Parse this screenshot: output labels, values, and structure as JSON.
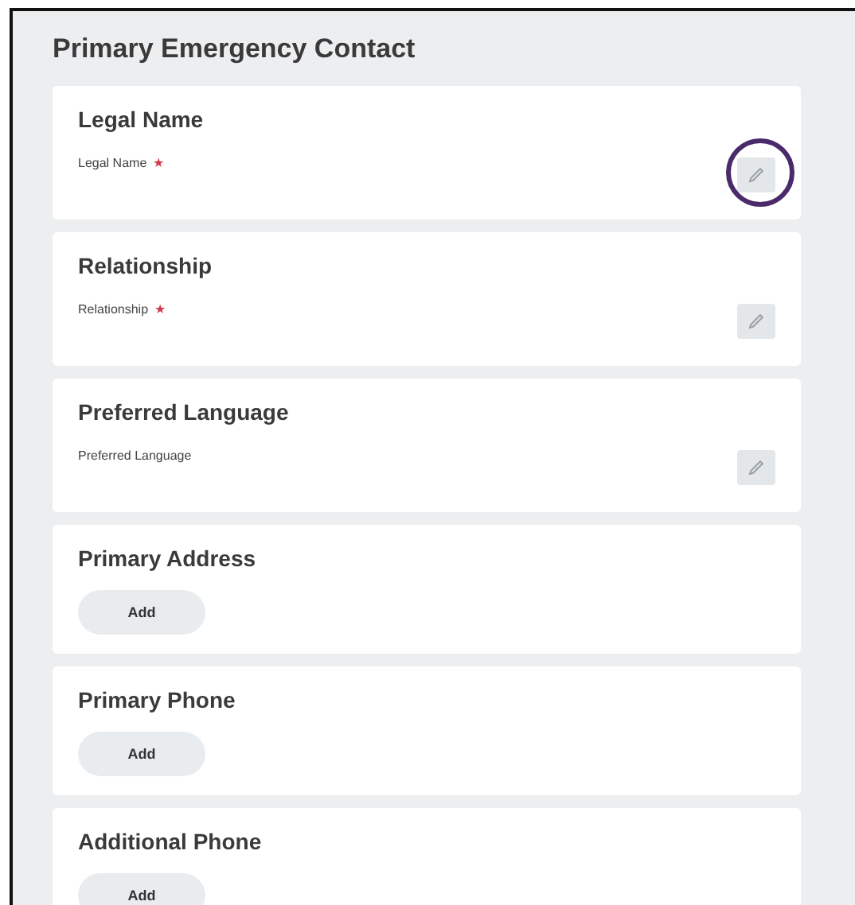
{
  "title": "Primary Emergency Contact",
  "sections": [
    {
      "kind": "field",
      "heading": "Legal Name",
      "label": "Legal Name",
      "required_mark": "★",
      "highlighted": true
    },
    {
      "kind": "field",
      "heading": "Relationship",
      "label": "Relationship",
      "required_mark": "★",
      "highlighted": false
    },
    {
      "kind": "field",
      "heading": "Preferred Language",
      "label": "Preferred Language",
      "highlighted": false
    },
    {
      "kind": "add",
      "heading": "Primary Address",
      "button": "Add"
    },
    {
      "kind": "add",
      "heading": "Primary Phone",
      "button": "Add"
    },
    {
      "kind": "add",
      "heading": "Additional Phone",
      "button": "Add"
    }
  ]
}
